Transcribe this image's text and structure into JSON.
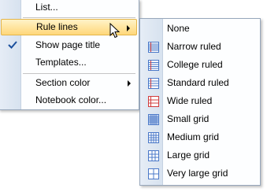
{
  "main_menu": {
    "items": [
      {
        "label": "List...",
        "accel": "L"
      },
      {
        "label": "Rule lines",
        "accel": "R"
      },
      {
        "label": "Show page title",
        "accel": "S"
      },
      {
        "label": "Templates...",
        "accel": "T"
      },
      {
        "label": "Section color",
        "accel": "c"
      },
      {
        "label": "Notebook color...",
        "accel": ""
      }
    ],
    "checked_item": "Show page title",
    "highlighted_item": "Rule lines"
  },
  "sub_menu": {
    "items": [
      {
        "label": "None",
        "icon": "none"
      },
      {
        "label": "Narrow ruled",
        "icon": "narrow-ruled-icon"
      },
      {
        "label": "College ruled",
        "icon": "college-ruled-icon"
      },
      {
        "label": "Standard ruled",
        "icon": "standard-ruled-icon"
      },
      {
        "label": "Wide ruled",
        "icon": "wide-ruled-icon"
      },
      {
        "label": "Small grid",
        "icon": "small-grid-icon"
      },
      {
        "label": "Medium grid",
        "icon": "medium-grid-icon"
      },
      {
        "label": "Large grid",
        "icon": "large-grid-icon"
      },
      {
        "label": "Very large grid",
        "icon": "very-large-grid-icon"
      }
    ]
  },
  "colors": {
    "highlight_top": "#fff3c8",
    "highlight_bottom": "#ffd77a",
    "rule_red": "#d23c3c",
    "rule_blue": "#4a78c8"
  }
}
